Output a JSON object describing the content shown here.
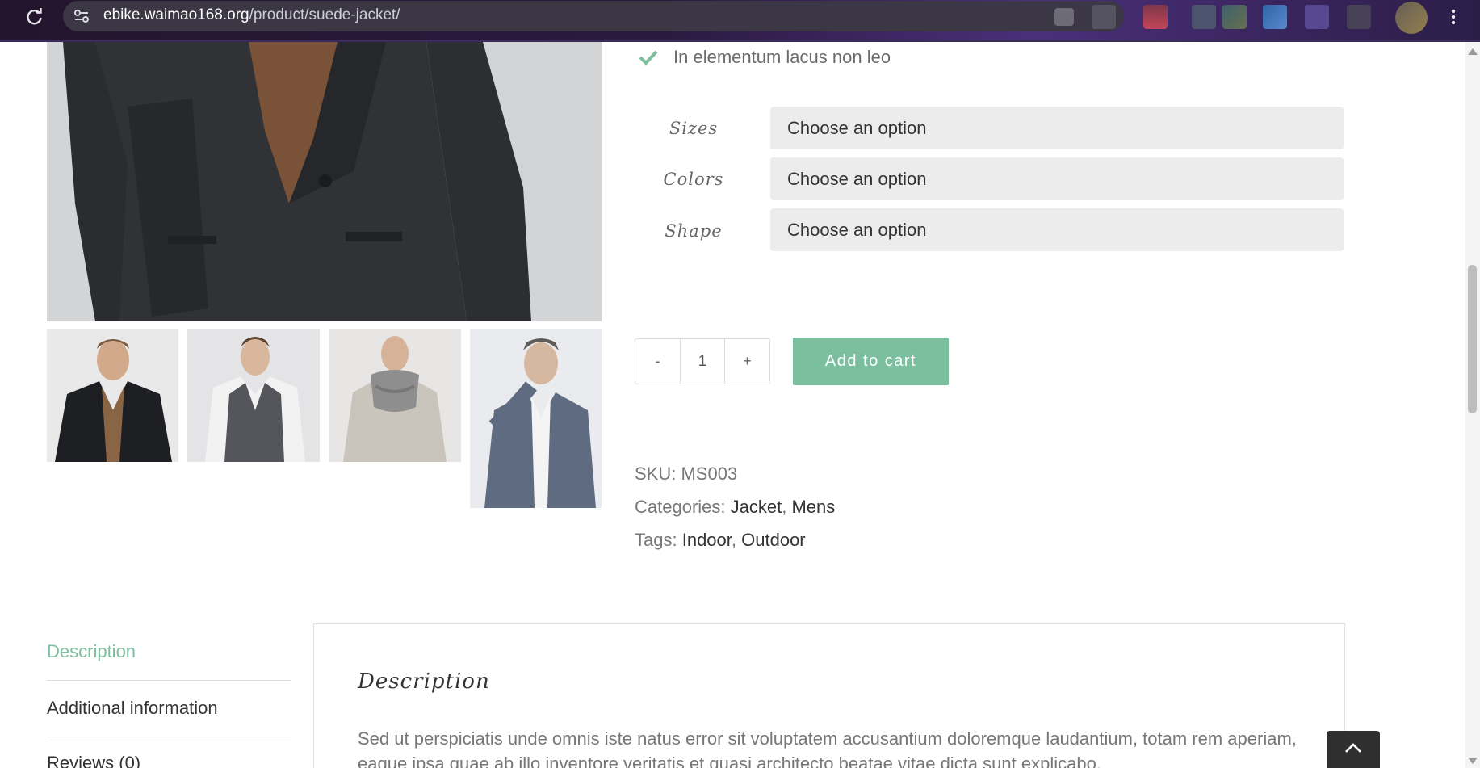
{
  "browser": {
    "url_host": "ebike.waimao168.org",
    "url_path": "/product/suede-jacket/"
  },
  "product": {
    "feature": "In elementum lacus non leo",
    "variations": [
      {
        "label": "Sizes",
        "value": "Choose an option"
      },
      {
        "label": "Colors",
        "value": "Choose an option"
      },
      {
        "label": "Shape",
        "value": "Choose an option"
      }
    ],
    "quantity": {
      "minus": "-",
      "value": "1",
      "plus": "+"
    },
    "add_to_cart": "Add to cart",
    "sku_label": "SKU:",
    "sku": "MS003",
    "categories_label": "Categories:",
    "categories": [
      "Jacket",
      "Mens"
    ],
    "tags_label": "Tags:",
    "tags": [
      "Indoor",
      "Outdoor"
    ],
    "separator": ","
  },
  "tabs": [
    {
      "label": "Description"
    },
    {
      "label": "Additional information"
    },
    {
      "label": "Reviews (0)"
    }
  ],
  "panel": {
    "title": "Description",
    "text": "Sed ut perspiciatis unde omnis iste natus error sit voluptatem accusantium doloremque laudantium, totam rem aperiam,",
    "text_line2": "eaque ipsa quae ab illo inventore veritatis et quasi architecto beatae vitae dicta sunt explicabo."
  },
  "colors": {
    "accent": "#7bbf9f",
    "select_bg": "#ececec",
    "to_top_bg": "#2f2f2f"
  },
  "icons": [
    "reload-icon",
    "site-settings-icon",
    "check-icon",
    "chevron-up-icon",
    "menu-dots-icon"
  ]
}
